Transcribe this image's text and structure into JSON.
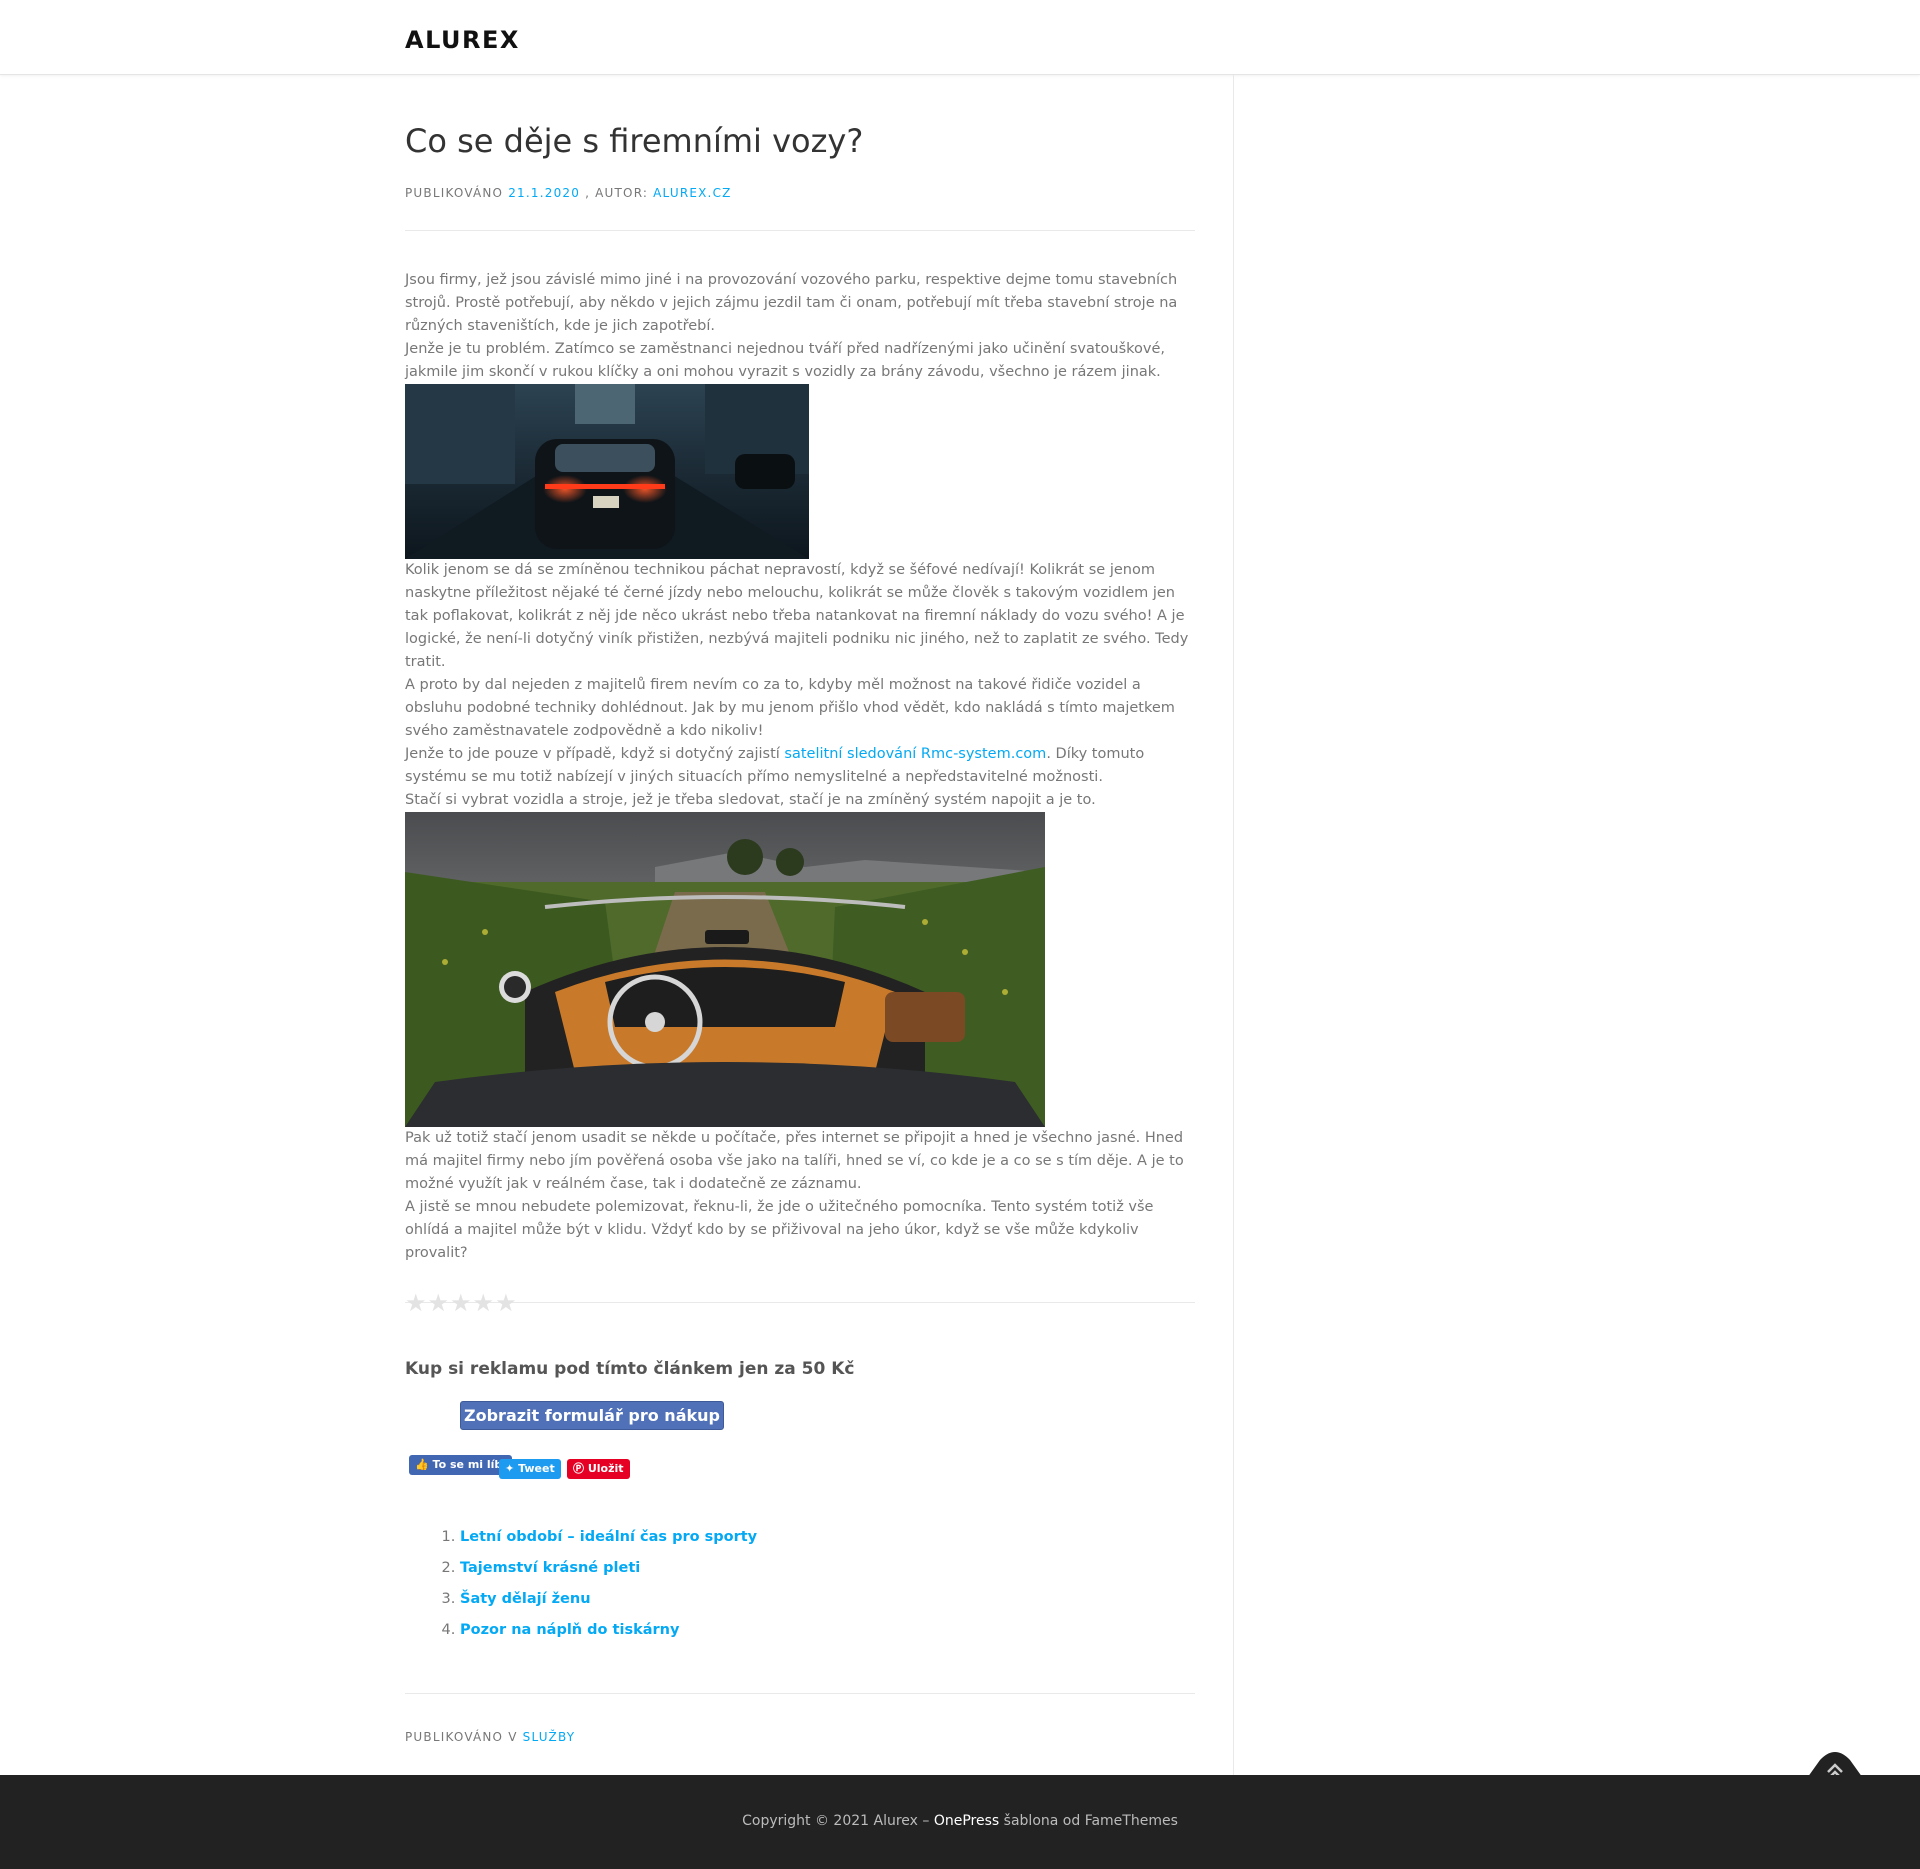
{
  "site": {
    "title": "ALUREX"
  },
  "post": {
    "title": "Co se děje s firemními vozy?",
    "meta": {
      "published_label": "Publikováno",
      "date": "21.1.2020",
      "author_label": ", Autor:",
      "author": "alurex.cz"
    },
    "paragraphs_1": [
      "Jsou firmy, jež jsou závislé mimo jiné i na provozování vozového parku, respektive dejme tomu stavebních strojů. Prostě potřebují, aby někdo v jejich zájmu jezdil tam či onam, potřebují mít třeba stavební stroje na různých staveništích, kde je jich zapotřebí.",
      "Jenže je tu problém. Zatímco se zaměstnanci nejednou tváří před nadřízenými jako učinění svatouškové, jakmile jim skončí v rukou klíčky a oni mohou vyrazit s vozidly za brány závodu, všechno je rázem jinak."
    ],
    "paragraphs_2": [
      "Kolik jenom se dá se zmíněnou technikou páchat nepravostí, když se šéfové nedívají! Kolikrát se jenom naskytne příležitost nějaké té černé jízdy nebo melouchu, kolikrát se může člověk s takovým vozidlem jen tak poflakovat, kolikrát z něj jde něco ukrást nebo třeba natankovat na firemní náklady do vozu svého! A je logické, že není-li dotyčný viník přistižen, nezbývá majiteli podniku nic jiného, než to zaplatit ze svého. Tedy tratit.",
      "A proto by dal nejeden z majitelů firem nevím co za to, kdyby měl možnost na takové řidiče vozidel a obsluhu podobné techniky dohlédnout. Jak by mu jenom přišlo vhod vědět, kdo nakládá s tímto majetkem svého zaměstnavatele zodpovědně a kdo nikoliv!"
    ],
    "link_paragraph": {
      "before": "Jenže to jde pouze v případě, když si dotyčný zajistí ",
      "link": "satelitní sledování Rmc-system.com",
      "after": ". Díky tomuto systému se mu totiž nabízejí v jiných situacích přímo nemyslitelné a nepředstavitelné možnosti."
    },
    "paragraph_3": "Stačí si vybrat vozidla a stroje, jež je třeba sledovat, stačí je na zmíněný systém napojit a je to.",
    "paragraphs_4": [
      "Pak už totiž stačí jenom usadit se někde u počítače, přes internet se připojit a hned je všechno jasné. Hned má majitel firmy nebo jím pověřená osoba vše jako na talíři, hned se ví, co kde je a co se s tím děje. A je to možné využít jak v reálném čase, tak i dodatečně ze záznamu.",
      "A jistě se mnou nebudete polemizovat, řeknu-li, že jde o užitečného pomocníka. Tento systém totiž vše ohlídá a majitel může být v klidu. Vždyť kdo by se přiživoval na jeho úkor, když se vše může kdykoliv provalit?"
    ],
    "rating": {
      "stars": 5,
      "value": 0
    },
    "ad": {
      "title": "Kup si reklamu pod tímto článkem jen za 50 Kč",
      "button": "Zobrazit formulář pro nákup"
    },
    "social": {
      "facebook": "To se mi líbí",
      "twitter": "Tweet",
      "pinterest": "Uložit"
    },
    "related": [
      "Letní období – ideální čas pro sporty",
      "Tajemství krásné pleti",
      "Šaty dělají ženu",
      "Pozor na náplň do tiskárny"
    ],
    "category": {
      "label": "Publikováno v",
      "name": "Služby"
    }
  },
  "footer": {
    "copyright": "Copyright © 2021 Alurex – ",
    "theme": "OnePress",
    "suffix": " šablona od FameThemes"
  },
  "colors": {
    "link": "#03a9f4",
    "footer_bg": "#222222",
    "button_bg": "#5071b7"
  }
}
